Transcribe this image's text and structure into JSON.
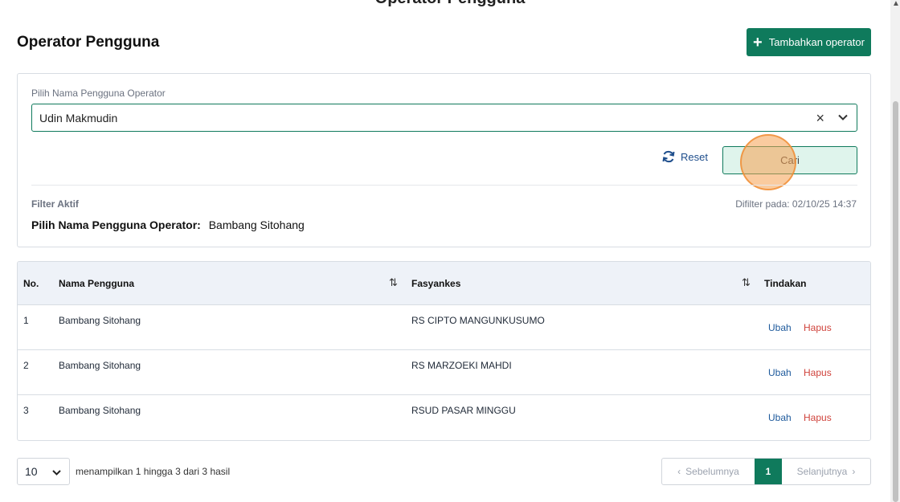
{
  "top_title": "Operator Pengguna",
  "header": {
    "title": "Operator Pengguna",
    "add_button": "Tambahkan operator"
  },
  "filter": {
    "label": "Pilih Nama Pengguna Operator",
    "selected_value": "Udin Makmudin",
    "reset_label": "Reset",
    "search_label": "Cari",
    "active_label": "Filter Aktif",
    "filtered_at": "Difilter pada: 02/10/25 14:37",
    "active_key": "Pilih Nama Pengguna Operator:",
    "active_value": "Bambang Sitohang"
  },
  "table": {
    "columns": [
      "No.",
      "Nama Pengguna",
      "Fasyankes",
      "Tindakan"
    ],
    "rows": [
      {
        "no": "1",
        "name": "Bambang Sitohang",
        "facility": "RS CIPTO MANGUNKUSUMO",
        "edit": "Ubah",
        "delete": "Hapus"
      },
      {
        "no": "2",
        "name": "Bambang Sitohang",
        "facility": "RS MARZOEKI MAHDI",
        "edit": "Ubah",
        "delete": "Hapus"
      },
      {
        "no": "3",
        "name": "Bambang Sitohang",
        "facility": "RSUD PASAR MINGGU",
        "edit": "Ubah",
        "delete": "Hapus"
      }
    ]
  },
  "footer": {
    "per_page": "10",
    "showing": "menampilkan 1 hingga 3 dari 3 hasil",
    "prev": "Sebelumnya",
    "current_page": "1",
    "next": "Selanjutnya"
  },
  "colors": {
    "accent": "#0f7a5c",
    "link": "#1e5a9c",
    "danger": "#d0433c"
  },
  "icons": [
    "plus-icon",
    "close-icon",
    "chevron-down-icon",
    "refresh-icon",
    "sort-icon",
    "chevron-left-icon",
    "chevron-right-icon"
  ]
}
